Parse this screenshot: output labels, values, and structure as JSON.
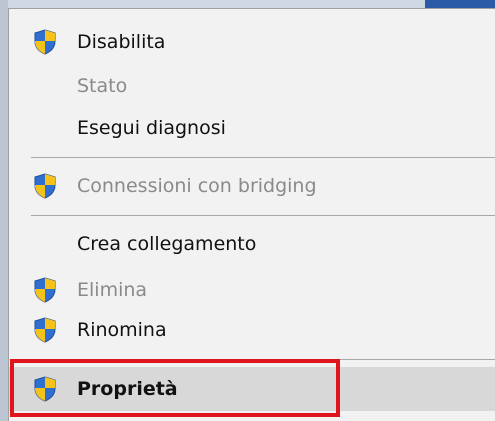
{
  "menu": {
    "items": [
      {
        "label": "Disabilita",
        "icon": "uac-shield-icon",
        "enabled": true
      },
      {
        "label": "Stato",
        "icon": "",
        "enabled": false
      },
      {
        "label": "Esegui diagnosi",
        "icon": "",
        "enabled": true
      },
      {
        "label": "Connessioni con bridging",
        "icon": "uac-shield-icon",
        "enabled": false
      },
      {
        "label": "Crea collegamento",
        "icon": "",
        "enabled": true
      },
      {
        "label": "Elimina",
        "icon": "uac-shield-icon",
        "enabled": false
      },
      {
        "label": "Rinomina",
        "icon": "uac-shield-icon",
        "enabled": true
      },
      {
        "label": "Proprietà",
        "icon": "uac-shield-icon",
        "enabled": true,
        "highlighted": true
      }
    ]
  },
  "colors": {
    "menu_bg": "#f2f2f2",
    "highlight_bg": "#d8d8d8",
    "annotation_box": "#e0141b",
    "shield_blue": "#2f6fd0",
    "shield_yellow": "#f5c21b"
  }
}
